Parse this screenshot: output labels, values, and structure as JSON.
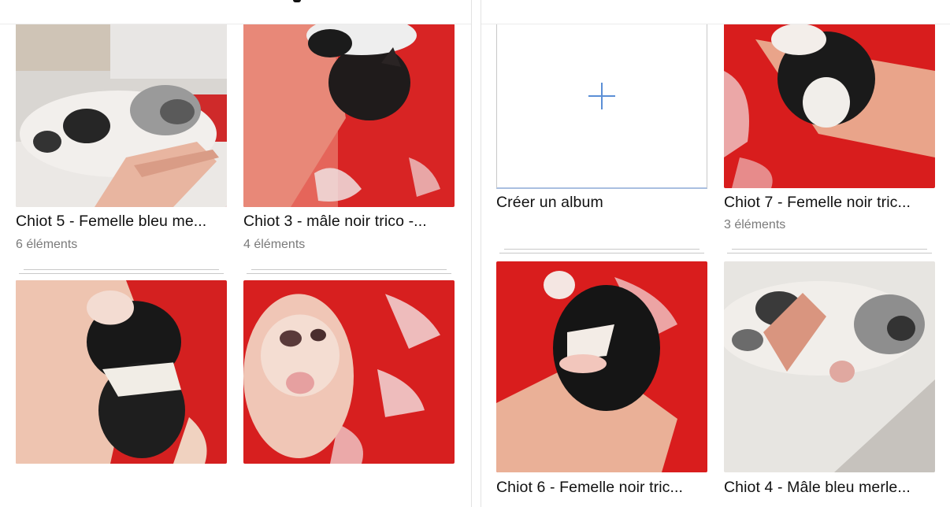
{
  "colors": {
    "accent": "#5b8fd6",
    "count_text": "#7a7a7a"
  },
  "left_panel": {
    "albums": [
      {
        "title": "Chiot 5 - Femelle bleu me...",
        "count": "6 éléments",
        "image": "puppy-merle-in-hand"
      },
      {
        "title": "Chiot 3 - mâle noir trico -...",
        "count": "4 éléments",
        "image": "puppy-black-on-red-blanket"
      },
      {
        "title": "",
        "count": "",
        "image": "puppy-black-white-in-hand"
      },
      {
        "title": "",
        "count": "",
        "image": "puppy-merle-on-red-blanket"
      }
    ]
  },
  "right_panel": {
    "create_album": {
      "label": "Créer un album",
      "icon": "plus-icon"
    },
    "albums": [
      {
        "title": "Chiot 7 - Femelle noir tric...",
        "count": "3 éléments",
        "image": "puppy-black-white-on-arm"
      },
      {
        "title": "Chiot 6 - Femelle noir tric...",
        "count": "",
        "image": "puppy-black-in-hand-red"
      },
      {
        "title": "Chiot 4 - Mâle bleu merle...",
        "count": "",
        "image": "puppy-merle-on-towel"
      }
    ]
  }
}
